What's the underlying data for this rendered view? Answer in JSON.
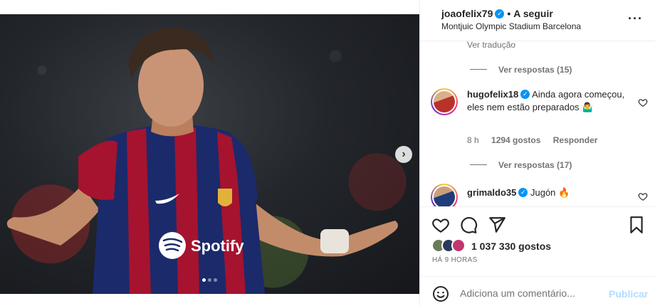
{
  "post": {
    "username": "joaofelix79",
    "follow_sep": "•",
    "follow_label": "A seguir",
    "location": "Montjuic Olympic Stadium Barcelona",
    "more_icon": "more-horizontal-icon"
  },
  "media": {
    "sponsor_text": "Spotify",
    "carousel": {
      "count": 3,
      "active": 1
    }
  },
  "comments": {
    "translate_label": "Ver tradução",
    "replies_1": "Ver respostas (15)",
    "replies_2": "Ver respostas (17)",
    "items": [
      {
        "username": "hugofelix18",
        "text": "Ainda agora começou, eles nem estão preparados",
        "emoji": "🤷‍♂️",
        "time": "8 h",
        "likes": "1294 gostos",
        "reply_label": "Responder"
      },
      {
        "username": "grimaldo35",
        "text": "Jugón",
        "emoji": "🔥"
      }
    ]
  },
  "actions": {
    "likes_count": "1 037 330 gostos",
    "posted": "HÁ 9 HORAS"
  },
  "add_comment": {
    "placeholder": "Adiciona um comentário...",
    "publish_label": "Publicar"
  },
  "colors": {
    "accent": "#0095f6",
    "publish_disabled": "#b3dbff",
    "muted_text": "#737373"
  }
}
